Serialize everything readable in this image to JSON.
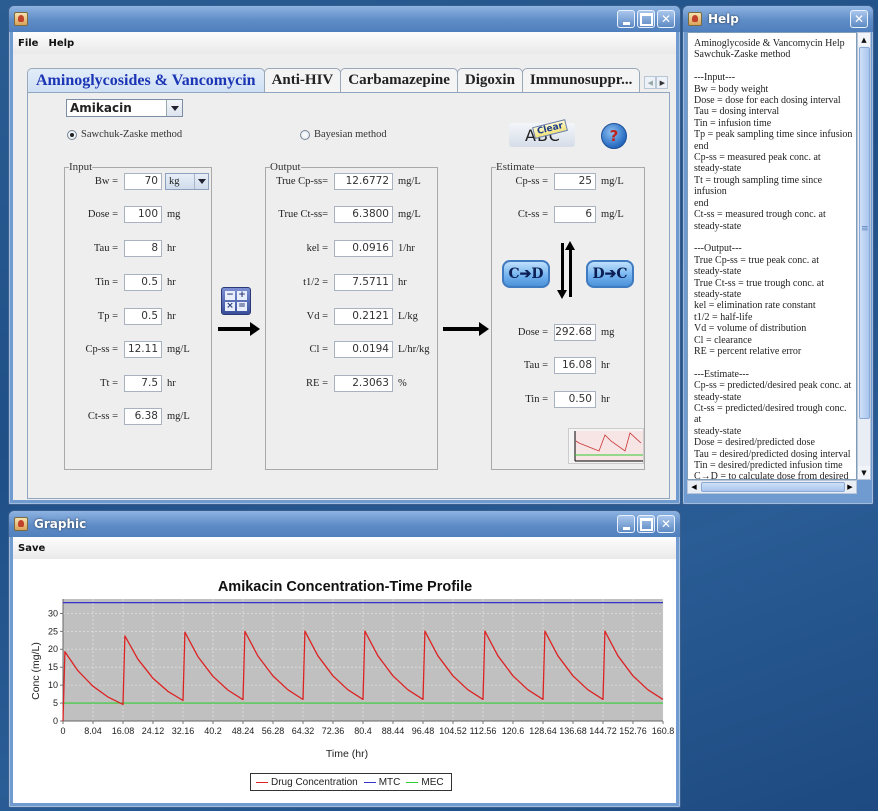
{
  "main_window": {
    "title": "",
    "menu": [
      "File",
      "Help"
    ],
    "tabs": [
      "Aminoglycosides & Vancomycin",
      "Anti-HIV",
      "Carbamazepine",
      "Digoxin",
      "Immunosuppr..."
    ],
    "active_tab": "Aminoglycosides & Vancomycin",
    "drug_select": "Amikacin",
    "methods": [
      {
        "label": "Sawchuk-Zaske method",
        "selected": true
      },
      {
        "label": "Bayesian method",
        "selected": false
      }
    ],
    "buttons": {
      "clear": "Clear",
      "clear_abc": "ABC",
      "help": "?",
      "c_to_d": "C➔D",
      "d_to_c": "D➔C",
      "calc": [
        "−",
        "+",
        "×",
        "="
      ]
    },
    "input": {
      "legend": "Input",
      "fields": [
        {
          "label": "Bw =",
          "value": "70",
          "unit": "kg",
          "unit_is_select": true
        },
        {
          "label": "Dose =",
          "value": "100",
          "unit": "mg"
        },
        {
          "label": "Tau =",
          "value": "8",
          "unit": "hr"
        },
        {
          "label": "Tin =",
          "value": "0.5",
          "unit": "hr"
        },
        {
          "label": "Tp =",
          "value": "0.5",
          "unit": "hr"
        },
        {
          "label": "Cp-ss =",
          "value": "12.11",
          "unit": "mg/L"
        },
        {
          "label": "Tt =",
          "value": "7.5",
          "unit": "hr"
        },
        {
          "label": "Ct-ss =",
          "value": "6.38",
          "unit": "mg/L"
        }
      ]
    },
    "output": {
      "legend": "Output",
      "fields": [
        {
          "label": "True Cp-ss=",
          "value": "12.6772",
          "unit": "mg/L"
        },
        {
          "label": "True Ct-ss=",
          "value": "6.3800",
          "unit": "mg/L"
        },
        {
          "label": "kel =",
          "value": "0.0916",
          "unit": "1/hr"
        },
        {
          "label": "t1/2 =",
          "value": "7.5711",
          "unit": "hr"
        },
        {
          "label": "Vd =",
          "value": "0.2121",
          "unit": "L/kg"
        },
        {
          "label": "Cl =",
          "value": "0.0194",
          "unit": "L/hr/kg"
        },
        {
          "label": "RE =",
          "value": "2.3063",
          "unit": "%"
        }
      ]
    },
    "estimate": {
      "legend": "Estimate",
      "conc_fields": [
        {
          "label": "Cp-ss =",
          "value": "25",
          "unit": "mg/L"
        },
        {
          "label": "Ct-ss =",
          "value": "6",
          "unit": "mg/L"
        }
      ],
      "dose_fields": [
        {
          "label": "Dose =",
          "value": "292.68",
          "unit": "mg"
        },
        {
          "label": "Tau =",
          "value": "16.08",
          "unit": "hr"
        },
        {
          "label": "Tin =",
          "value": "0.50",
          "unit": "hr"
        }
      ]
    }
  },
  "help_window": {
    "title": "Help",
    "text": "Aminoglycoside & Vancomycin Help\nSawchuk-Zaske method\n\n---Input---\nBw = body weight\nDose = dose for each dosing interval\nTau = dosing interval\nTin = infusion time\nTp = peak sampling time since infusion\nend\nCp-ss = measured peak conc. at\nsteady-state\nTt = trough sampling time since infusion\nend\nCt-ss = measured trough conc. at\nsteady-state\n\n---Output---\nTrue Cp-ss = true peak conc. at\nsteady-state\nTrue Ct-ss = true trough conc. at\nsteady-state\nkel = elimination rate constant\nt1/2 = half-life\nVd = volume of distribution\nCl = clearance\nRE = percent relative error\n\n---Estimate---\nCp-ss = predicted/desired peak conc. at\nsteady-state\nCt-ss = predicted/desired trough conc. at\nsteady-state\nDose = desired/predicted dose\nTau = desired/predicted dosing interval\nTin = desired/predicted infusion time\nC→D = to calculate dose from desired\nconc.\nD→C = to calculate conc. from desired"
  },
  "graphic_window": {
    "title": "Graphic",
    "menu": [
      "Save"
    ]
  },
  "colors": {
    "drug": "#dd2222",
    "mtc": "#3333cc",
    "mec": "#33cc33",
    "plot_bg": "#c0c0c0",
    "active_tab_text": "#1c35b5"
  },
  "chart_data": {
    "type": "line",
    "title": "Amikacin Concentration-Time Profile",
    "xlabel": "Time (hr)",
    "ylabel": "Conc (mg/L)",
    "xlim": [
      0,
      160.8
    ],
    "ylim": [
      0,
      34
    ],
    "xticks": [
      "0",
      "8.04",
      "16.08",
      "24.12",
      "32.16",
      "40.2",
      "48.24",
      "56.28",
      "64.32",
      "72.36",
      "80.4",
      "88.44",
      "96.48",
      "104.52",
      "112.56",
      "120.6",
      "128.64",
      "136.68",
      "144.72",
      "152.76",
      "160.8"
    ],
    "yticks": [
      "0",
      "5",
      "10",
      "15",
      "20",
      "25",
      "30"
    ],
    "grid": true,
    "legend": "bottom-center",
    "series": [
      {
        "name": "Drug Concentration",
        "x": [
          0,
          0.5,
          4,
          8,
          12,
          16.08,
          16.58,
          20.08,
          24.08,
          28.08,
          32.16,
          32.66,
          36.16,
          40.16,
          44.16,
          48.24,
          48.74,
          52.24,
          56.24,
          60.24,
          64.32,
          64.82,
          68.32,
          72.32,
          76.32,
          80.4,
          80.9,
          84.4,
          88.4,
          92.4,
          96.48,
          96.98,
          100.48,
          104.48,
          108.48,
          112.56,
          113.06,
          116.56,
          120.56,
          124.56,
          128.64,
          129.14,
          132.64,
          136.64,
          140.64,
          144.72,
          145.22,
          148.72,
          152.72,
          156.72,
          160.8
        ],
        "y": [
          0,
          19.3,
          14.01,
          9.71,
          6.73,
          4.63,
          23.72,
          17.21,
          11.93,
          8.27,
          5.7,
          24.74,
          17.95,
          12.45,
          8.63,
          5.94,
          24.97,
          18.12,
          12.56,
          8.71,
          6.0,
          25.03,
          18.16,
          12.59,
          8.73,
          6.01,
          25.03,
          18.16,
          12.59,
          8.73,
          6.01,
          25.03,
          18.16,
          12.59,
          8.73,
          6.01,
          25.03,
          18.16,
          12.59,
          8.73,
          6.01,
          25.03,
          18.16,
          12.59,
          8.73,
          6.01,
          25.03,
          18.16,
          12.59,
          8.73,
          6.01
        ]
      },
      {
        "name": "MTC",
        "value": 33
      },
      {
        "name": "MEC",
        "value": 5
      }
    ]
  }
}
